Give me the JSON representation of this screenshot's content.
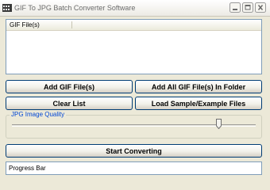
{
  "window": {
    "title": "GIF To JPG Batch Converter Software"
  },
  "file_list": {
    "column_header": "GIF File(s)",
    "items": []
  },
  "buttons": {
    "add_files": "Add GIF File(s)",
    "add_folder": "Add All GIF File(s) In Folder",
    "clear_list": "Clear List",
    "load_sample": "Load Sample/Example Files",
    "start": "Start Converting"
  },
  "quality": {
    "label": "JPG Image Quality",
    "value_fraction": 0.85
  },
  "progress": {
    "label": "Progress Bar"
  },
  "colors": {
    "group_label": "#0046d5",
    "button_border": "#003c74"
  }
}
